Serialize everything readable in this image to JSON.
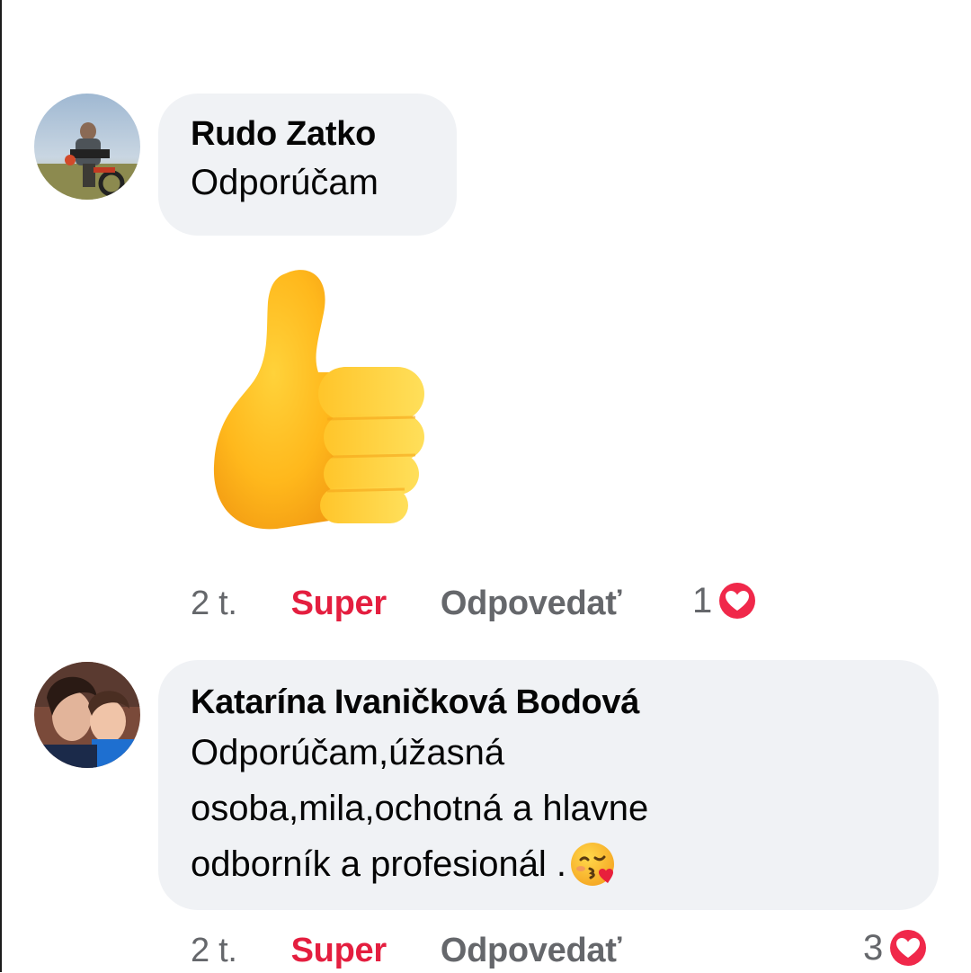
{
  "comments": [
    {
      "author": "Rudo Zatko",
      "text": "Odporúčam",
      "sticker_icon": "thumbs-up-icon",
      "time": "2 t.",
      "reaction_label": "Super",
      "reply_label": "Odpovedať",
      "reaction_count": "1",
      "reaction_icon": "heart-icon"
    },
    {
      "author": "Katarína Ivaničková Bodová",
      "text_lines": [
        "Odporúčam,úžasná",
        "osoba,mila,ochotná a hlavne",
        "odborník a profesionál ."
      ],
      "emoji_icon": "kissing-heart-emoji-icon",
      "time": "2 t.",
      "reaction_label": "Super",
      "reply_label": "Odpovedať",
      "reaction_count": "3",
      "reaction_icon": "heart-icon"
    }
  ],
  "colors": {
    "bubble": "#f0f2f5",
    "reaction_accent": "#e41e3f",
    "meta_gray": "#65676b"
  }
}
